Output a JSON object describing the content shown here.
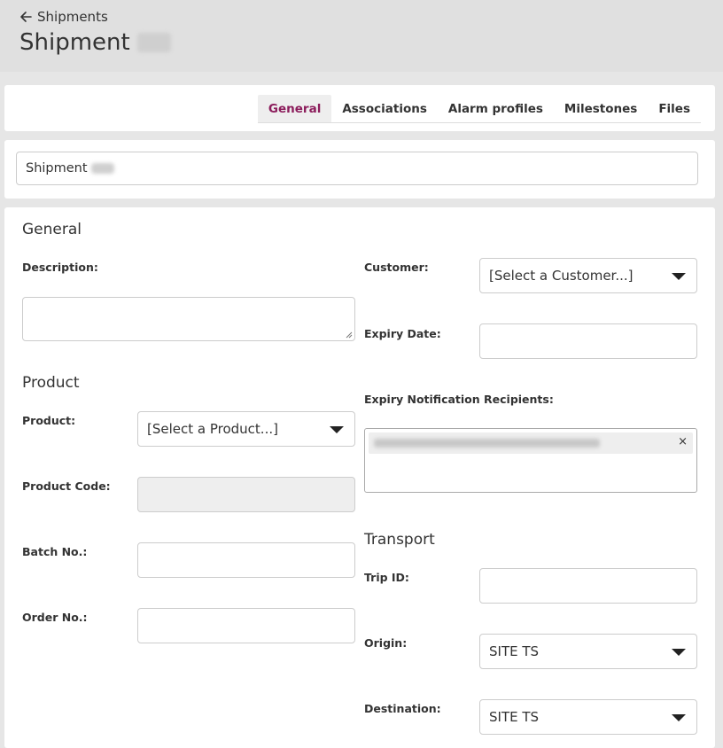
{
  "header": {
    "back_label": "Shipments",
    "title": "Shipment"
  },
  "tabs": [
    {
      "label": "General",
      "active": true
    },
    {
      "label": "Associations"
    },
    {
      "label": "Alarm profiles"
    },
    {
      "label": "Milestones"
    },
    {
      "label": "Files"
    }
  ],
  "name_field": {
    "value": "Shipment"
  },
  "general": {
    "title": "General",
    "description_label": "Description:",
    "customer_label": "Customer:",
    "customer_placeholder": "[Select a Customer...]",
    "expiry_date_label": "Expiry Date:",
    "expiry_recipients_label": "Expiry Notification Recipients:",
    "chip_remove": "×"
  },
  "product": {
    "title": "Product",
    "product_label": "Product:",
    "product_placeholder": "[Select a Product...]",
    "product_code_label": "Product Code:",
    "batch_label": "Batch No.:",
    "order_label": "Order No.:"
  },
  "transport": {
    "title": "Transport",
    "trip_label": "Trip ID:",
    "origin_label": "Origin:",
    "origin_value": "SITE TS",
    "destination_label": "Destination:",
    "destination_value": "SITE TS"
  },
  "colors": {
    "accent": "#8c1d5c",
    "header_bg": "#e0e0e0",
    "page_bg": "#e6e6e6"
  },
  "icons": {
    "back": "arrow-left-icon",
    "dropdown": "caret-down-icon",
    "remove": "close-icon"
  }
}
